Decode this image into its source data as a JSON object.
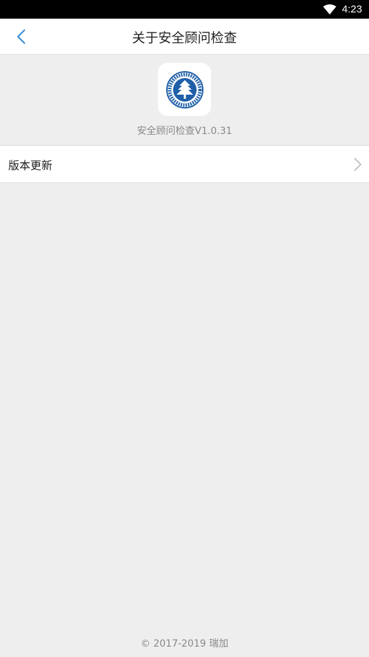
{
  "status_bar": {
    "time": "4:23",
    "wifi_icon": "wifi-icon"
  },
  "nav": {
    "back_icon": "chevron-left-icon",
    "title": "关于安全顾问检查"
  },
  "about": {
    "app_icon": "university-seal-icon",
    "version": "安全顾问检查V1.0.31"
  },
  "menu": [
    {
      "label": "版本更新",
      "icon": "chevron-right-icon"
    }
  ],
  "footer": {
    "copyright": "© 2017-2019 瑞加"
  },
  "colors": {
    "accent": "#2e8ad8",
    "background": "#eeeeee",
    "seal": "#1f5fa8"
  }
}
